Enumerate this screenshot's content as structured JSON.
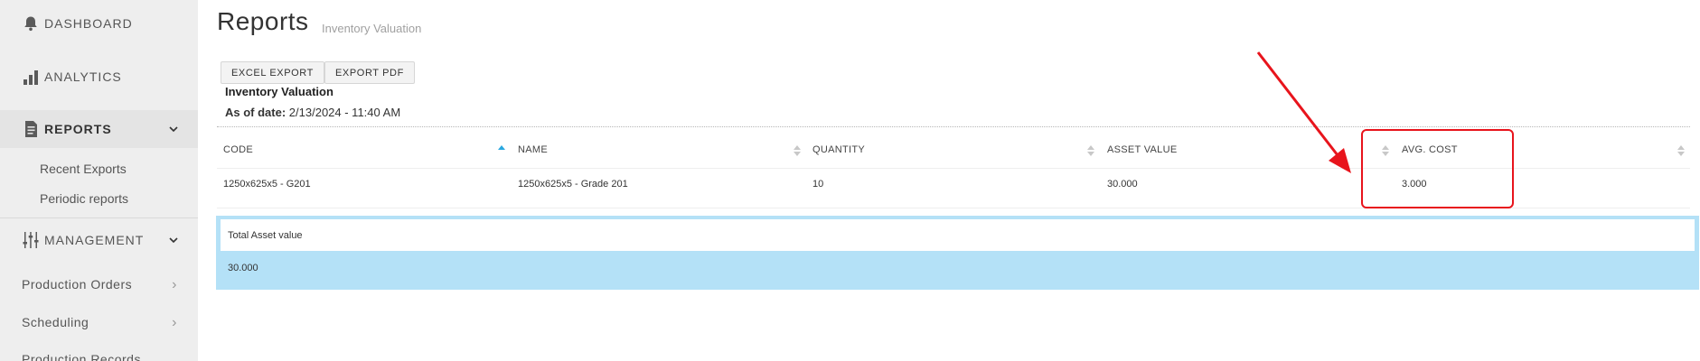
{
  "sidebar": {
    "dashboard": "DASHBOARD",
    "analytics": "ANALYTICS",
    "reports": "REPORTS",
    "reports_sub": [
      "Recent Exports",
      "Periodic reports"
    ],
    "management": "MANAGEMENT",
    "management_sub": [
      "Production Orders",
      "Scheduling",
      "Production Records"
    ]
  },
  "header": {
    "title": "Reports",
    "subtitle": "Inventory Valuation"
  },
  "toolbar": {
    "excel_export": "EXCEL EXPORT",
    "export_pdf": "EXPORT PDF"
  },
  "report": {
    "name": "Inventory Valuation",
    "as_of_label": "As of date:",
    "as_of_value": "2/13/2024 - 11:40 AM"
  },
  "table": {
    "columns": [
      "CODE",
      "NAME",
      "QUANTITY",
      "ASSET VALUE",
      "AVG. COST"
    ],
    "rows": [
      [
        "1250x625x5 - G201",
        "1250x625x5 - Grade 201",
        "10",
        "30.000",
        "3.000"
      ]
    ]
  },
  "totals": {
    "label": "Total Asset value",
    "value": "30.000"
  },
  "colors": {
    "sidebar_bg": "#eeeeee",
    "total_panel": "#b4e1f7",
    "sort_active": "#29a8e0",
    "annotation": "#e8141c"
  }
}
